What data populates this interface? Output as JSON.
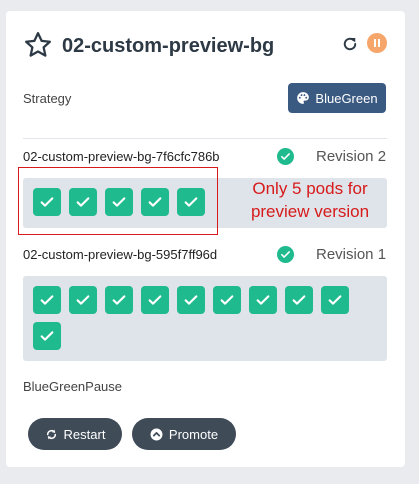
{
  "rollout": {
    "title": "02-custom-preview-bg",
    "strategy_label": "Strategy",
    "strategy_value": "BlueGreen"
  },
  "replicasets": [
    {
      "name": "02-custom-preview-bg-7f6cfc786b",
      "revision": "Revision 2",
      "pods": 5
    },
    {
      "name": "02-custom-preview-bg-595f7ff96d",
      "revision": "Revision 1",
      "pods": 10
    }
  ],
  "annotation": {
    "text": "Only 5 pods for preview version"
  },
  "current_step": "BlueGreenPause",
  "actions": {
    "restart": "Restart",
    "promote": "Promote"
  },
  "colors": {
    "pod_ok": "#1fba8d",
    "strategy_button": "#3b5a82",
    "action_button": "#3f4b57",
    "pause_button": "#f6a56b",
    "annotation": "#d71a1a"
  },
  "icons": {
    "favorite": "star-icon",
    "refresh": "refresh-icon",
    "pause": "pause-icon",
    "strategy": "palette-icon",
    "pod_status": "check-icon",
    "restart": "restart-icon",
    "promote": "promote-icon"
  }
}
